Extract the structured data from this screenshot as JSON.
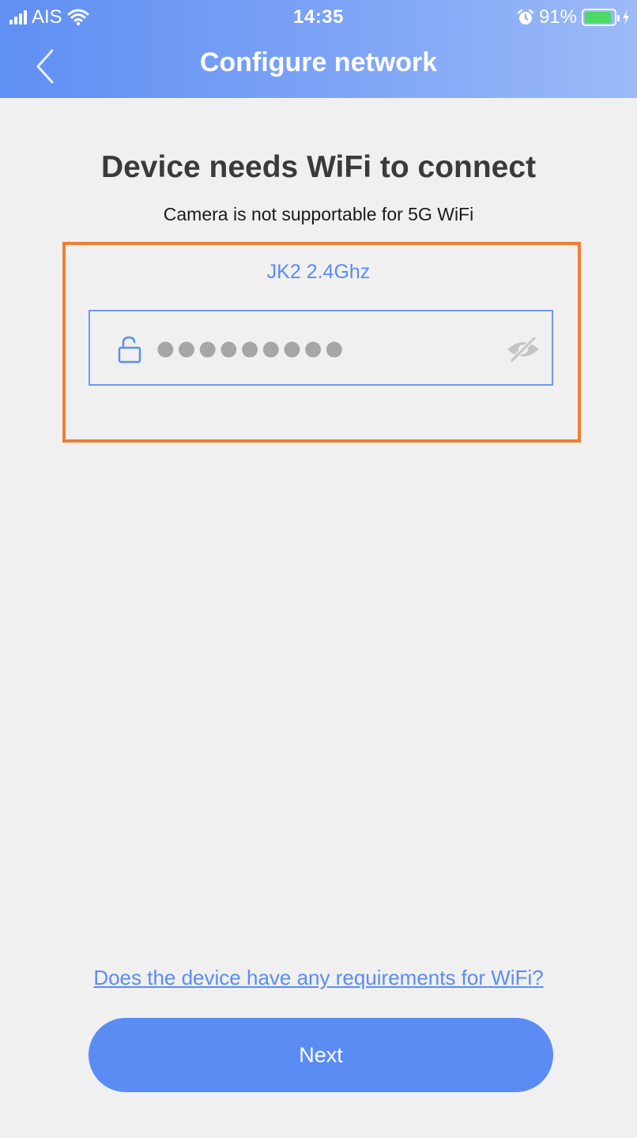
{
  "status_bar": {
    "carrier": "AIS",
    "time": "14:35",
    "battery_percent": "91%",
    "battery_level": 0.91
  },
  "nav": {
    "title": "Configure network"
  },
  "main": {
    "heading": "Device needs WiFi to connect",
    "subtitle": "Camera is not supportable for 5G WiFi",
    "network_name": "JK2 2.4Ghz",
    "password_masked": "●●●●●●●●●",
    "requirements_link": "Does the device have any requirements for WiFi?",
    "next_label": "Next"
  },
  "colors": {
    "accent": "#5b8cf4",
    "highlight": "#ee7f31",
    "background": "#f0f0f0",
    "battery": "#4cd964"
  },
  "icons": [
    "signal-icon",
    "wifi-icon",
    "alarm-icon",
    "battery-icon",
    "charging-icon",
    "back-chevron-icon",
    "lock-icon",
    "eye-hidden-icon"
  ]
}
